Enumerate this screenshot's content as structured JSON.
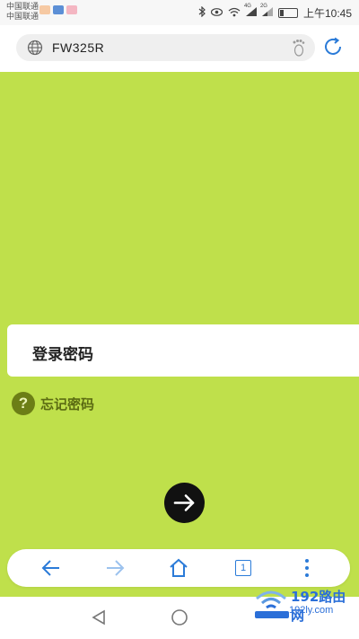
{
  "status_bar": {
    "carrier_1": "中国联通",
    "carrier_2": "中国联通",
    "signal_1": "4G",
    "signal_2": "2G",
    "battery_percent": 25,
    "time": "上午10:45",
    "notification_icons": [
      "weibo-icon",
      "news-icon",
      "app-icon"
    ],
    "icons": [
      "bluetooth-icon",
      "eye-icon",
      "wifi-icon",
      "signal-icon",
      "signal-icon",
      "battery-icon"
    ]
  },
  "browser": {
    "url": "FW325R",
    "address_icons": [
      "globe-icon",
      "footprint-icon",
      "refresh-icon"
    ],
    "accent_color": "#2b7bd8",
    "toolbar_icons": [
      "back-icon",
      "forward-icon",
      "home-icon",
      "tabs-icon",
      "more-icon"
    ],
    "tab_count": "1"
  },
  "page": {
    "background_color": "#bfe04b",
    "password_placeholder": "登录密码",
    "forgot_password": "忘记密码",
    "help_glyph": "?",
    "submit_icon": "arrow-right-icon"
  },
  "watermark": {
    "title": "192路由网",
    "url": "192ly.com"
  }
}
